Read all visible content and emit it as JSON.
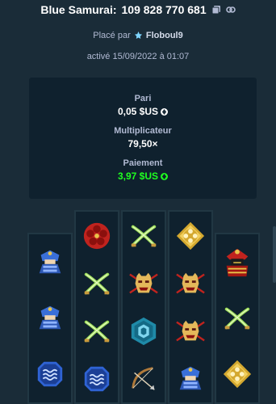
{
  "header": {
    "game": "Blue Samurai:",
    "bet_id": "109 828 770 681",
    "icons": [
      "copy-icon",
      "link-icon"
    ]
  },
  "meta": {
    "placed_prefix": "Placé par",
    "player": "Floboul9",
    "activated": "activé 15/09/2022 à 01:07"
  },
  "stats": {
    "bet_label": "Pari",
    "bet_value": "0,05 $US",
    "multiplier_label": "Multiplicateur",
    "multiplier_value": "79,50×",
    "payout_label": "Paiement",
    "payout_value": "3,97 $US"
  },
  "colors": {
    "background": "#1a2c38",
    "panel": "#0f212e",
    "payout": "#1fff20"
  },
  "reels": [
    [
      "samurai",
      "samurai",
      "wave-emblem"
    ],
    [
      "flower-emblem",
      "crossed-swords",
      "crossed-swords",
      "wave-emblem"
    ],
    [
      "crossed-swords",
      "mask",
      "hex-emblem",
      "bow"
    ],
    [
      "gold-emblem",
      "mask",
      "mask",
      "samurai"
    ],
    [
      "armor",
      "crossed-swords",
      "gold-emblem"
    ]
  ]
}
